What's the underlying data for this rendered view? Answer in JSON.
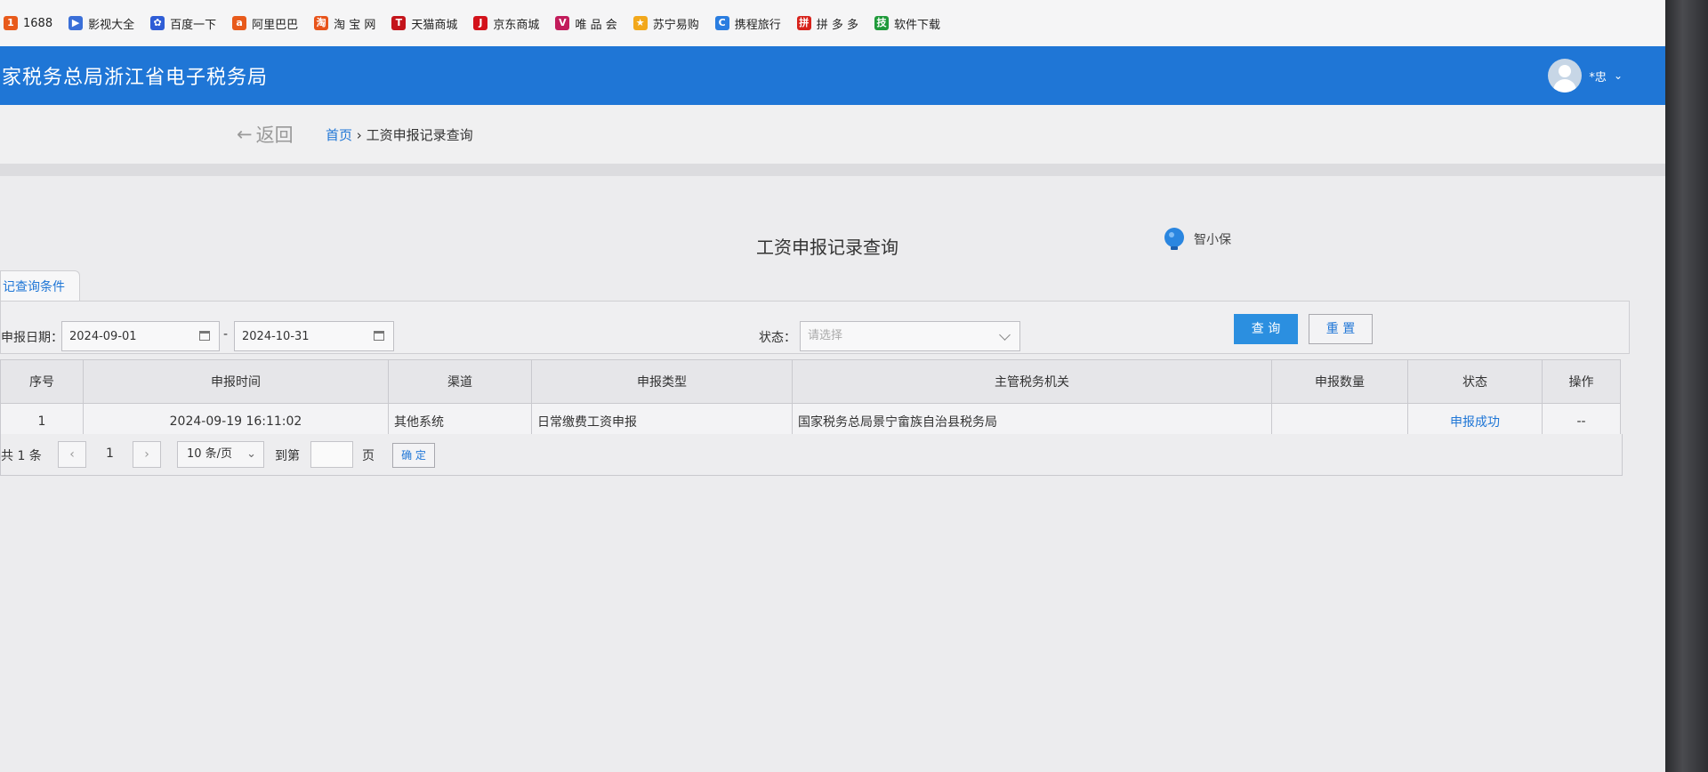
{
  "bookmarks": [
    {
      "label": "1688",
      "icon": "1688-icon",
      "color": "#e85a1b",
      "glyph": "1"
    },
    {
      "label": "影视大全",
      "icon": "video-icon",
      "color": "#3a6fd8",
      "glyph": "▶"
    },
    {
      "label": "百度一下",
      "icon": "baidu-icon",
      "color": "#2f5dd6",
      "glyph": "✿"
    },
    {
      "label": "阿里巴巴",
      "icon": "alibaba-icon",
      "color": "#e85a1b",
      "glyph": "a"
    },
    {
      "label": "淘 宝 网",
      "icon": "taobao-icon",
      "color": "#e8541b",
      "glyph": "淘"
    },
    {
      "label": "天猫商城",
      "icon": "tmall-icon",
      "color": "#c4141b",
      "glyph": "T"
    },
    {
      "label": "京东商城",
      "icon": "jd-icon",
      "color": "#d3121b",
      "glyph": "J"
    },
    {
      "label": "唯 品 会",
      "icon": "vip-icon",
      "color": "#c21c5b",
      "glyph": "V"
    },
    {
      "label": "苏宁易购",
      "icon": "suning-icon",
      "color": "#f2a81b",
      "glyph": "★"
    },
    {
      "label": "携程旅行",
      "icon": "ctrip-icon",
      "color": "#2a7de0",
      "glyph": "C"
    },
    {
      "label": "拼 多 多",
      "icon": "pdd-icon",
      "color": "#d7221b",
      "glyph": "拼"
    },
    {
      "label": "软件下载",
      "icon": "download-icon",
      "color": "#1f9a3a",
      "glyph": "技"
    }
  ],
  "header": {
    "title": "家税务总局浙江省电子税务局",
    "user": "*忠",
    "bg": "#1f76d6"
  },
  "subbar": {
    "back_label": "返回",
    "crumb_home": "首页",
    "crumb_sep": "›",
    "crumb_current": "工资申报记录查询"
  },
  "page": {
    "title": "工资申报记录查询",
    "assistant": "智小保",
    "tab_label": "记查询条件"
  },
  "filter": {
    "date_label": "申报日期：",
    "date_from": "2024-09-01",
    "date_dash": "-",
    "date_to": "2024-10-31",
    "status_label": "状态：",
    "status_placeholder": "请选择",
    "query_button": "查 询",
    "reset_button": "重 置"
  },
  "table": {
    "columns": [
      "序号",
      "申报时间",
      "渠道",
      "申报类型",
      "主管税务机关",
      "申报数量",
      "状态",
      "操作"
    ],
    "rows": [
      [
        "1",
        "2024-09-19 16:11:02",
        "其他系统",
        "日常缴费工资申报",
        "国家税务总局景宁畲族自治县税务局",
        "",
        "申报成功",
        "--"
      ]
    ]
  },
  "pager": {
    "total_text": "共 1 条",
    "prev": "‹",
    "current_page": "1",
    "next": "›",
    "page_size": "10 条/页",
    "goto_label": "到第",
    "page_unit": "页",
    "confirm": "确 定"
  }
}
